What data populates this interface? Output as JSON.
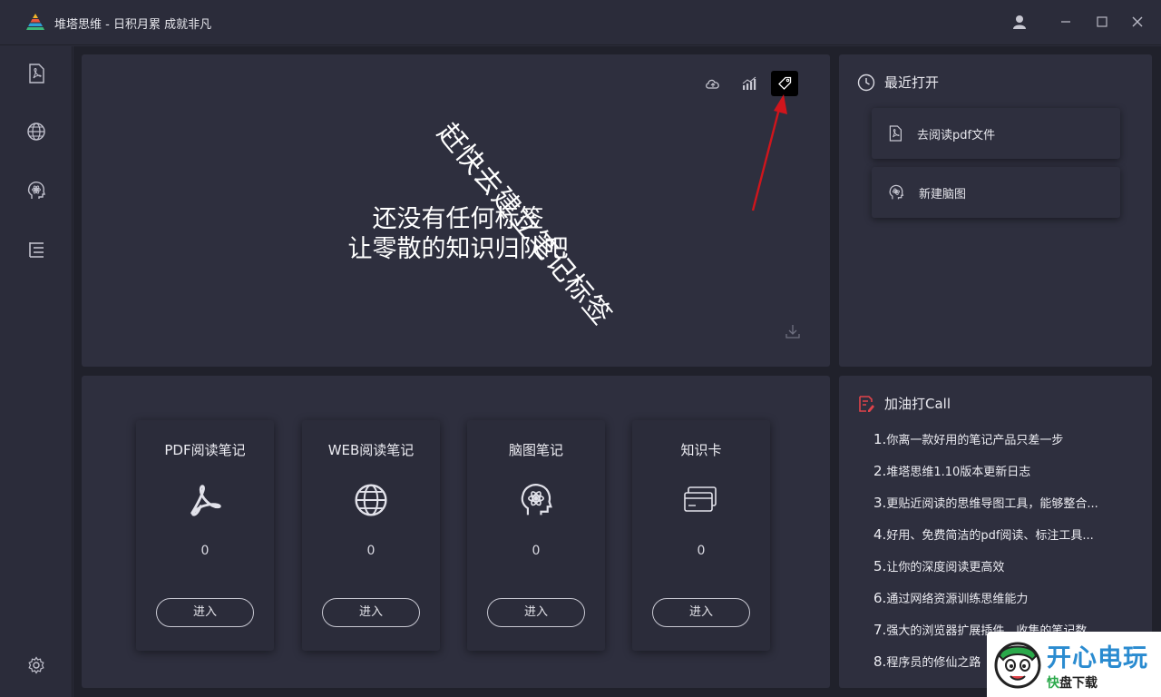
{
  "app": {
    "title": "堆塔思维 - 日积月累 成就非凡",
    "window_controls": [
      "user-icon",
      "minimize-icon",
      "maximize-icon",
      "close-icon"
    ]
  },
  "sidebar": {
    "items": [
      {
        "icon": "pdf-icon"
      },
      {
        "icon": "globe-icon"
      },
      {
        "icon": "brain-icon"
      },
      {
        "icon": "list-tree-icon"
      }
    ],
    "bottom_icon": "settings-icon"
  },
  "tags_panel": {
    "toolbar": [
      "cloud-icon",
      "chart-icon",
      "tag-icon"
    ],
    "active_tool": "tag-icon",
    "empty_line1": "还没有任何标签",
    "empty_line2": "让零散的知识归队吧",
    "annotation": "赶快去建立笔记标签",
    "annotation_color": "#d0151c"
  },
  "recent": {
    "title": "最近打开",
    "items": [
      {
        "label": "去阅读pdf文件",
        "icon": "pdf-icon"
      },
      {
        "label": "新建脑图",
        "icon": "brain-icon"
      }
    ]
  },
  "notes": {
    "cards": [
      {
        "title": "PDF阅读笔记",
        "icon": "acrobat-icon",
        "count": "0",
        "button": "进入"
      },
      {
        "title": "WEB阅读笔记",
        "icon": "globe-icon",
        "count": "0",
        "button": "进入"
      },
      {
        "title": "脑图笔记",
        "icon": "brain-icon",
        "count": "0",
        "button": "进入"
      },
      {
        "title": "知识卡",
        "icon": "cards-icon",
        "count": "0",
        "button": "进入"
      }
    ]
  },
  "call": {
    "title": "加油打Call",
    "accent": "#e0434a",
    "items": [
      {
        "num": "1.",
        "text": "你离一款好用的笔记产品只差一步"
      },
      {
        "num": "2.",
        "text": "堆塔思维1.10版本更新日志"
      },
      {
        "num": "3.",
        "text": "更贴近阅读的思维导图工具，能够整合..."
      },
      {
        "num": "4.",
        "text": "好用、免费简洁的pdf阅读、标注工具..."
      },
      {
        "num": "5.",
        "text": "让你的深度阅读更高效"
      },
      {
        "num": "6.",
        "text": "通过网络资源训练思维能力"
      },
      {
        "num": "7.",
        "text": "强大的浏览器扩展插件，收集的笔记数..."
      },
      {
        "num": "8.",
        "text": "程序员的修仙之路"
      }
    ]
  },
  "watermark": {
    "main": "开心电玩",
    "sub1": "快",
    "sub2": "盘下载"
  }
}
